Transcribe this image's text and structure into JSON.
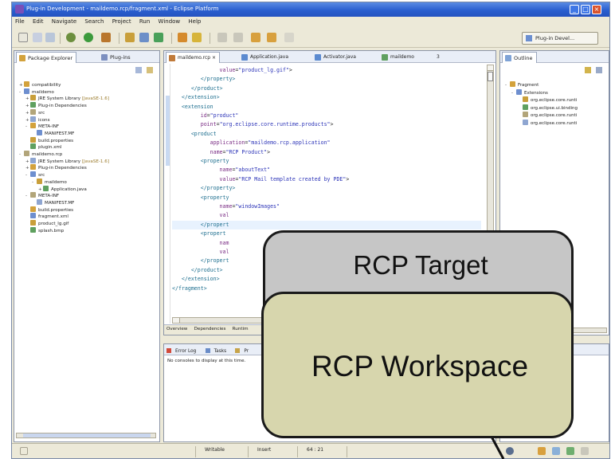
{
  "window": {
    "title": "Plug-in Development - maildemo.rcp/fragment.xml - Eclipse Platform"
  },
  "menu": [
    "File",
    "Edit",
    "Navigate",
    "Search",
    "Project",
    "Run",
    "Window",
    "Help"
  ],
  "perspective": {
    "label": "Plug-in Devel..."
  },
  "left_panel": {
    "tabs": [
      "Package Explorer",
      "Plug-ins"
    ],
    "tree": [
      {
        "label": "compatibility",
        "level": 0,
        "toggle": "+"
      },
      {
        "label": "maildemo",
        "level": 0,
        "toggle": "-"
      },
      {
        "label": "JRE System Library",
        "decoration": "[JavaSE-1.6]",
        "level": 1,
        "toggle": "+"
      },
      {
        "label": "Plug-in Dependencies",
        "level": 1,
        "toggle": "+"
      },
      {
        "label": "src",
        "level": 1,
        "toggle": "+"
      },
      {
        "label": "icons",
        "level": 1,
        "toggle": "+"
      },
      {
        "label": "META-INF",
        "level": 1,
        "toggle": "-"
      },
      {
        "label": "MANIFEST.MF",
        "level": 2,
        "toggle": ""
      },
      {
        "label": "build.properties",
        "level": 1,
        "toggle": ""
      },
      {
        "label": "plugin.xml",
        "level": 1,
        "toggle": ""
      },
      {
        "label": "maildemo.rcp",
        "level": 0,
        "toggle": "-"
      },
      {
        "label": "JRE System Library",
        "decoration": "[JavaSE-1.6]",
        "level": 1,
        "toggle": "+"
      },
      {
        "label": "Plug-in Dependencies",
        "level": 1,
        "toggle": "+"
      },
      {
        "label": "src",
        "level": 1,
        "toggle": "-"
      },
      {
        "label": "maildemo",
        "level": 2,
        "toggle": "-"
      },
      {
        "label": "Application.java",
        "level": 3,
        "toggle": "+"
      },
      {
        "label": "META-INF",
        "level": 1,
        "toggle": "-"
      },
      {
        "label": "MANIFEST.MF",
        "level": 2,
        "toggle": ""
      },
      {
        "label": "build.properties",
        "level": 1,
        "toggle": ""
      },
      {
        "label": "fragment.xml",
        "level": 1,
        "toggle": ""
      },
      {
        "label": "product_lg.gif",
        "level": 1,
        "toggle": ""
      },
      {
        "label": "splash.bmp",
        "level": 1,
        "toggle": ""
      }
    ]
  },
  "editor": {
    "tabs": [
      "maildemo.rcp",
      "Application.java",
      "Activator.java",
      "maildemo"
    ],
    "tab_overflow": "3",
    "lines": [
      [
        {
          "t": "               "
        },
        {
          "t": "value",
          "c": "attr"
        },
        {
          "t": "="
        },
        {
          "t": "\"product_lg.gif\"",
          "c": "val"
        },
        {
          "t": ">"
        }
      ],
      [
        {
          "t": "         "
        },
        {
          "t": "</property>",
          "c": "tag"
        }
      ],
      [
        {
          "t": "      "
        },
        {
          "t": "</product>",
          "c": "tag"
        }
      ],
      [
        {
          "t": "   "
        },
        {
          "t": "</extension>",
          "c": "tag"
        }
      ],
      [
        {
          "t": "   "
        },
        {
          "t": "<extension",
          "c": "tag"
        }
      ],
      [
        {
          "t": "         "
        },
        {
          "t": "id",
          "c": "attr"
        },
        {
          "t": "="
        },
        {
          "t": "\"product\"",
          "c": "val"
        }
      ],
      [
        {
          "t": "         "
        },
        {
          "t": "point",
          "c": "attr"
        },
        {
          "t": "="
        },
        {
          "t": "\"org.eclipse.core.runtime.products\"",
          "c": "val"
        },
        {
          "t": ">"
        }
      ],
      [
        {
          "t": "      "
        },
        {
          "t": "<product",
          "c": "tag"
        }
      ],
      [
        {
          "t": "            "
        },
        {
          "t": "application",
          "c": "attr"
        },
        {
          "t": "="
        },
        {
          "t": "\"maildemo.rcp.application\"",
          "c": "val"
        }
      ],
      [
        {
          "t": "            "
        },
        {
          "t": "name",
          "c": "attr"
        },
        {
          "t": "="
        },
        {
          "t": "\"RCP Product\"",
          "c": "val"
        },
        {
          "t": ">"
        }
      ],
      [
        {
          "t": "         "
        },
        {
          "t": "<property",
          "c": "tag"
        }
      ],
      [
        {
          "t": "               "
        },
        {
          "t": "name",
          "c": "attr"
        },
        {
          "t": "="
        },
        {
          "t": "\"aboutText\"",
          "c": "val"
        }
      ],
      [
        {
          "t": "               "
        },
        {
          "t": "value",
          "c": "attr"
        },
        {
          "t": "="
        },
        {
          "t": "\"RCP Mail template created by PDE\"",
          "c": "val"
        },
        {
          "t": ">"
        }
      ],
      [
        {
          "t": "         "
        },
        {
          "t": "</property>",
          "c": "tag"
        }
      ],
      [
        {
          "t": "         "
        },
        {
          "t": "<property",
          "c": "tag"
        }
      ],
      [
        {
          "t": "               "
        },
        {
          "t": "name",
          "c": "attr"
        },
        {
          "t": "="
        },
        {
          "t": "\"windowImages\"",
          "c": "val"
        }
      ],
      [
        {
          "t": "               "
        },
        {
          "t": "val",
          "c": "attr"
        }
      ],
      [
        {
          "t": "         "
        },
        {
          "t": "</propert",
          "c": "tag"
        }
      ],
      [
        {
          "t": "         "
        },
        {
          "t": "<propert",
          "c": "tag"
        }
      ],
      [
        {
          "t": "               "
        },
        {
          "t": "nam",
          "c": "attr"
        }
      ],
      [
        {
          "t": "               "
        },
        {
          "t": "val",
          "c": "attr"
        }
      ],
      [
        {
          "t": "         "
        },
        {
          "t": "</propert",
          "c": "tag"
        }
      ],
      [
        {
          "t": "      "
        },
        {
          "t": "</product>",
          "c": "tag"
        }
      ],
      [
        {
          "t": "   "
        },
        {
          "t": "</extension>",
          "c": "tag"
        }
      ],
      [
        {
          "t": ""
        },
        {
          "t": "</fragment>",
          "c": "tag"
        }
      ]
    ],
    "bottom_tabs": [
      "Overview",
      "Dependencies",
      "Runtim"
    ]
  },
  "console": {
    "tabs": [
      "Error Log",
      "Tasks",
      "Pr"
    ],
    "message": "No consoles to display at this time."
  },
  "outline": {
    "tab": "Outline",
    "tree": [
      {
        "label": "Fragment",
        "level": 0,
        "toggle": "-"
      },
      {
        "label": "Extensions",
        "level": 1,
        "toggle": "-"
      },
      {
        "label": "org.eclipse.core.runti",
        "level": 2,
        "toggle": ""
      },
      {
        "label": "org.eclipse.ui.binding",
        "level": 2,
        "toggle": ""
      },
      {
        "label": "org.eclipse.core.runti",
        "level": 2,
        "toggle": ""
      },
      {
        "label": "org.eclipse.core.runti",
        "level": 2,
        "toggle": ""
      }
    ]
  },
  "statusbar": {
    "mode": "Writable",
    "insert": "Insert",
    "position": "64 : 21"
  },
  "overlay": {
    "target_label": "RCP Target",
    "workspace_label": "RCP Workspace"
  },
  "colors": {
    "target_fill": "#c6c6c6",
    "workspace_fill": "#d7d6ad",
    "title_blue": "#2a5fcf"
  }
}
